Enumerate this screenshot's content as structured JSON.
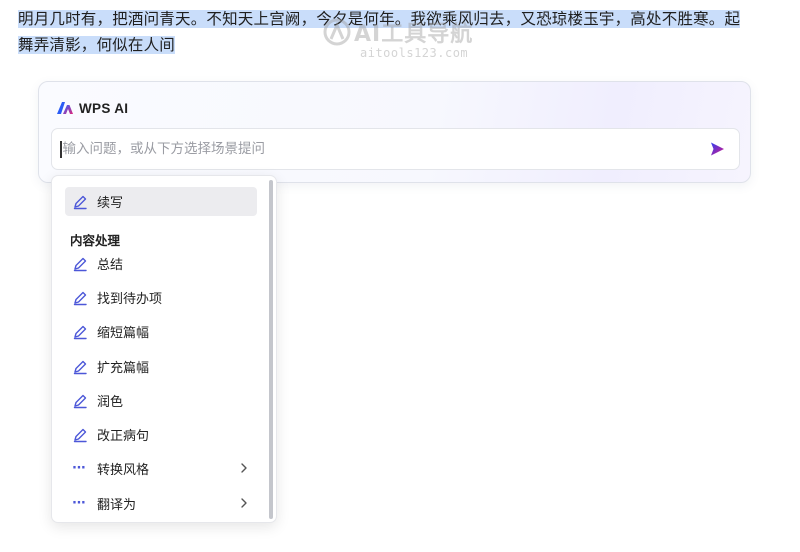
{
  "document": {
    "line1": "明月几时有，把酒问青天。不知天上宫阙，今夕是何年。我欲乘风归去，又恐琼楼玉宇，高处不胜寒。起",
    "line2": "舞弄清影，何似在人间"
  },
  "watermark": {
    "title": "AI工具导航",
    "url": "aitools123.com"
  },
  "ai_panel": {
    "title": "WPS AI",
    "input": {
      "value": "",
      "placeholder": "输入问题，或从下方选择场景提问"
    },
    "send_icon": "send-arrow-icon"
  },
  "menu": {
    "top_item": {
      "label": "续写",
      "icon": "pen-icon"
    },
    "section_title": "内容处理",
    "items": [
      {
        "label": "总结",
        "icon": "pen-icon"
      },
      {
        "label": "找到待办项",
        "icon": "pen-icon"
      },
      {
        "label": "缩短篇幅",
        "icon": "pen-icon"
      },
      {
        "label": "扩充篇幅",
        "icon": "pen-icon"
      },
      {
        "label": "润色",
        "icon": "pen-icon"
      },
      {
        "label": "改正病句",
        "icon": "pen-icon"
      },
      {
        "label": "转换风格",
        "icon": "more-dots-icon",
        "submenu": true
      },
      {
        "label": "翻译为",
        "icon": "more-dots-icon",
        "submenu": true
      }
    ]
  },
  "colors": {
    "accent": "#4c57d8",
    "selection": "#c9ddfa",
    "active_item": "#ececef"
  }
}
